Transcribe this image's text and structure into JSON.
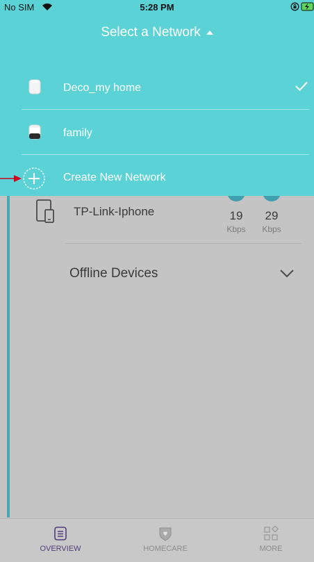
{
  "status_bar": {
    "carrier": "No SIM",
    "time": "5:28 PM"
  },
  "header": {
    "title": "Select a Network"
  },
  "networks": [
    {
      "name": "Deco_my home",
      "selected": true
    },
    {
      "name": "family",
      "selected": false
    }
  ],
  "create_network": {
    "label": "Create New Network"
  },
  "device": {
    "name": "TP-Link-Iphone",
    "upload": {
      "value": "19",
      "unit": "Kbps"
    },
    "download": {
      "value": "29",
      "unit": "Kbps"
    }
  },
  "offline": {
    "label": "Offline Devices"
  },
  "tabs": [
    {
      "label": "OVERVIEW",
      "icon": "overview-icon",
      "active": true
    },
    {
      "label": "HOMECARE",
      "icon": "homecare-shield-icon",
      "active": false
    },
    {
      "label": "MORE",
      "icon": "more-grid-icon",
      "active": false
    }
  ],
  "colors": {
    "overlay": "#5bd2d6",
    "accent": "#4aa6b3",
    "active_tab": "#4e3f7a",
    "annotation": "#d0021b"
  }
}
